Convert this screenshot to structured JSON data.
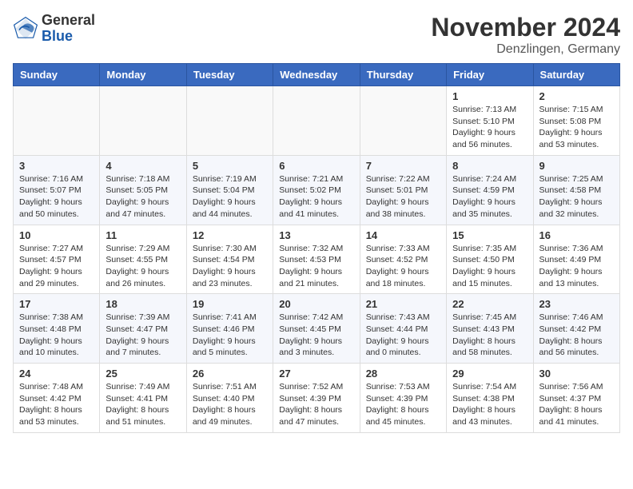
{
  "header": {
    "logo_general": "General",
    "logo_blue": "Blue",
    "month_title": "November 2024",
    "location": "Denzlingen, Germany"
  },
  "weekdays": [
    "Sunday",
    "Monday",
    "Tuesday",
    "Wednesday",
    "Thursday",
    "Friday",
    "Saturday"
  ],
  "weeks": [
    [
      {
        "day": "",
        "info": ""
      },
      {
        "day": "",
        "info": ""
      },
      {
        "day": "",
        "info": ""
      },
      {
        "day": "",
        "info": ""
      },
      {
        "day": "",
        "info": ""
      },
      {
        "day": "1",
        "info": "Sunrise: 7:13 AM\nSunset: 5:10 PM\nDaylight: 9 hours and 56 minutes."
      },
      {
        "day": "2",
        "info": "Sunrise: 7:15 AM\nSunset: 5:08 PM\nDaylight: 9 hours and 53 minutes."
      }
    ],
    [
      {
        "day": "3",
        "info": "Sunrise: 7:16 AM\nSunset: 5:07 PM\nDaylight: 9 hours and 50 minutes."
      },
      {
        "day": "4",
        "info": "Sunrise: 7:18 AM\nSunset: 5:05 PM\nDaylight: 9 hours and 47 minutes."
      },
      {
        "day": "5",
        "info": "Sunrise: 7:19 AM\nSunset: 5:04 PM\nDaylight: 9 hours and 44 minutes."
      },
      {
        "day": "6",
        "info": "Sunrise: 7:21 AM\nSunset: 5:02 PM\nDaylight: 9 hours and 41 minutes."
      },
      {
        "day": "7",
        "info": "Sunrise: 7:22 AM\nSunset: 5:01 PM\nDaylight: 9 hours and 38 minutes."
      },
      {
        "day": "8",
        "info": "Sunrise: 7:24 AM\nSunset: 4:59 PM\nDaylight: 9 hours and 35 minutes."
      },
      {
        "day": "9",
        "info": "Sunrise: 7:25 AM\nSunset: 4:58 PM\nDaylight: 9 hours and 32 minutes."
      }
    ],
    [
      {
        "day": "10",
        "info": "Sunrise: 7:27 AM\nSunset: 4:57 PM\nDaylight: 9 hours and 29 minutes."
      },
      {
        "day": "11",
        "info": "Sunrise: 7:29 AM\nSunset: 4:55 PM\nDaylight: 9 hours and 26 minutes."
      },
      {
        "day": "12",
        "info": "Sunrise: 7:30 AM\nSunset: 4:54 PM\nDaylight: 9 hours and 23 minutes."
      },
      {
        "day": "13",
        "info": "Sunrise: 7:32 AM\nSunset: 4:53 PM\nDaylight: 9 hours and 21 minutes."
      },
      {
        "day": "14",
        "info": "Sunrise: 7:33 AM\nSunset: 4:52 PM\nDaylight: 9 hours and 18 minutes."
      },
      {
        "day": "15",
        "info": "Sunrise: 7:35 AM\nSunset: 4:50 PM\nDaylight: 9 hours and 15 minutes."
      },
      {
        "day": "16",
        "info": "Sunrise: 7:36 AM\nSunset: 4:49 PM\nDaylight: 9 hours and 13 minutes."
      }
    ],
    [
      {
        "day": "17",
        "info": "Sunrise: 7:38 AM\nSunset: 4:48 PM\nDaylight: 9 hours and 10 minutes."
      },
      {
        "day": "18",
        "info": "Sunrise: 7:39 AM\nSunset: 4:47 PM\nDaylight: 9 hours and 7 minutes."
      },
      {
        "day": "19",
        "info": "Sunrise: 7:41 AM\nSunset: 4:46 PM\nDaylight: 9 hours and 5 minutes."
      },
      {
        "day": "20",
        "info": "Sunrise: 7:42 AM\nSunset: 4:45 PM\nDaylight: 9 hours and 3 minutes."
      },
      {
        "day": "21",
        "info": "Sunrise: 7:43 AM\nSunset: 4:44 PM\nDaylight: 9 hours and 0 minutes."
      },
      {
        "day": "22",
        "info": "Sunrise: 7:45 AM\nSunset: 4:43 PM\nDaylight: 8 hours and 58 minutes."
      },
      {
        "day": "23",
        "info": "Sunrise: 7:46 AM\nSunset: 4:42 PM\nDaylight: 8 hours and 56 minutes."
      }
    ],
    [
      {
        "day": "24",
        "info": "Sunrise: 7:48 AM\nSunset: 4:42 PM\nDaylight: 8 hours and 53 minutes."
      },
      {
        "day": "25",
        "info": "Sunrise: 7:49 AM\nSunset: 4:41 PM\nDaylight: 8 hours and 51 minutes."
      },
      {
        "day": "26",
        "info": "Sunrise: 7:51 AM\nSunset: 4:40 PM\nDaylight: 8 hours and 49 minutes."
      },
      {
        "day": "27",
        "info": "Sunrise: 7:52 AM\nSunset: 4:39 PM\nDaylight: 8 hours and 47 minutes."
      },
      {
        "day": "28",
        "info": "Sunrise: 7:53 AM\nSunset: 4:39 PM\nDaylight: 8 hours and 45 minutes."
      },
      {
        "day": "29",
        "info": "Sunrise: 7:54 AM\nSunset: 4:38 PM\nDaylight: 8 hours and 43 minutes."
      },
      {
        "day": "30",
        "info": "Sunrise: 7:56 AM\nSunset: 4:37 PM\nDaylight: 8 hours and 41 minutes."
      }
    ]
  ]
}
